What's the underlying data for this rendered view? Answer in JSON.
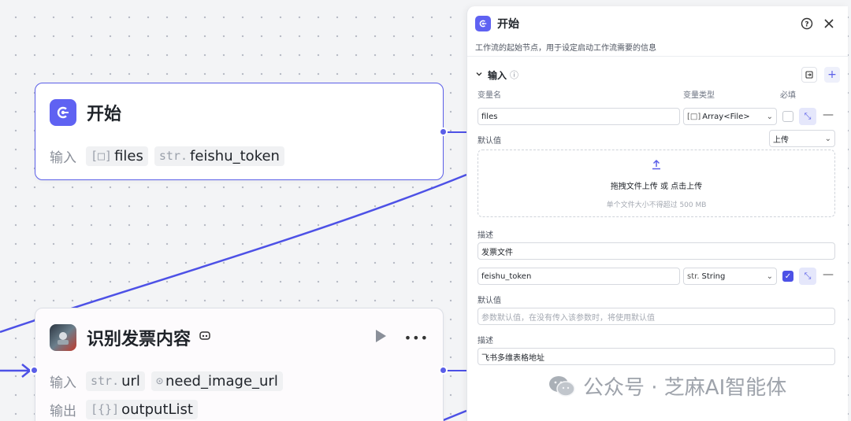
{
  "start_node": {
    "title": "开始",
    "input_label": "输入",
    "inputs": [
      {
        "type_prefix": "[□]",
        "name": "files"
      },
      {
        "type_prefix": "str.",
        "name": "feishu_token"
      }
    ]
  },
  "recognize_node": {
    "title": "识别发票内容",
    "input_label": "输入",
    "output_label": "输出",
    "inputs": [
      {
        "type_prefix": "str.",
        "name": "url"
      },
      {
        "type_prefix": "⊙",
        "name": "need_image_url"
      }
    ],
    "outputs": [
      {
        "type_prefix": "[{}]",
        "name": "outputList"
      }
    ],
    "more_glyph": "•••"
  },
  "panel": {
    "title": "开始",
    "description": "工作流的起始节点，用于设定启动工作流需要的信息",
    "section_title": "输入",
    "columns": {
      "name": "变量名",
      "type": "变量类型",
      "required": "必填"
    },
    "fields": [
      {
        "name": "files",
        "type": "Array<File>",
        "type_prefix": "[□]",
        "required": false,
        "default_label": "默认值",
        "default_mode": "上传",
        "upload_text": "拖拽文件上传 或 点击上传",
        "upload_hint": "单个文件大小不得超过 500 MB",
        "desc_label": "描述",
        "desc_value": "发票文件"
      },
      {
        "name": "feishu_token",
        "type": "String",
        "type_prefix": "str.",
        "required": true,
        "default_label": "默认值",
        "default_placeholder": "参数默认值，在没有传入该参数时，将使用默认值",
        "desc_label": "描述",
        "desc_value": "飞书多维表格地址"
      }
    ]
  },
  "watermark": {
    "text": "公众号 · 芝麻AI智能体"
  },
  "colors": {
    "accent": "#5a5ee8",
    "edge": "#4d51e6",
    "icon_bg": "#5f62f2"
  }
}
